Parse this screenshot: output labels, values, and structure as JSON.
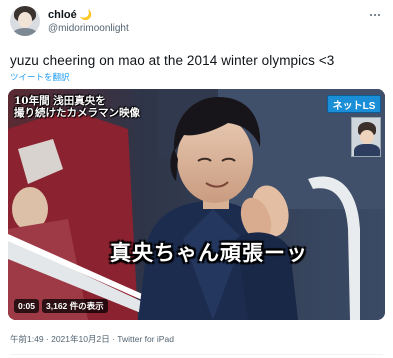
{
  "author": {
    "display_name": "chloé",
    "name_emoji": "🌙",
    "handle": "@midorimoonlight",
    "avatar_icon": "profile-avatar-icon"
  },
  "tweet": {
    "text": "yuzu cheering on mao at the 2014 winter olympics <3",
    "translate_label": "ツイートを翻訳",
    "more_icon": "more-options-icon"
  },
  "video": {
    "caption_top_line1": "10年間 浅田真央を",
    "caption_top_line2": "撮り続けたカメラマン映像",
    "channel_logo": "ネットLS",
    "subtitle": "真央ちゃん頑張ーッ",
    "duration": "0:05",
    "views": "3,162 件の表示"
  },
  "meta": {
    "timestamp_and_source": "午前1:49 · 2021年10月2日 · Twitter for iPad"
  },
  "colors": {
    "accent_link": "#1d9bf0",
    "secondary_text": "#536471",
    "primary_text": "#0f1419"
  }
}
